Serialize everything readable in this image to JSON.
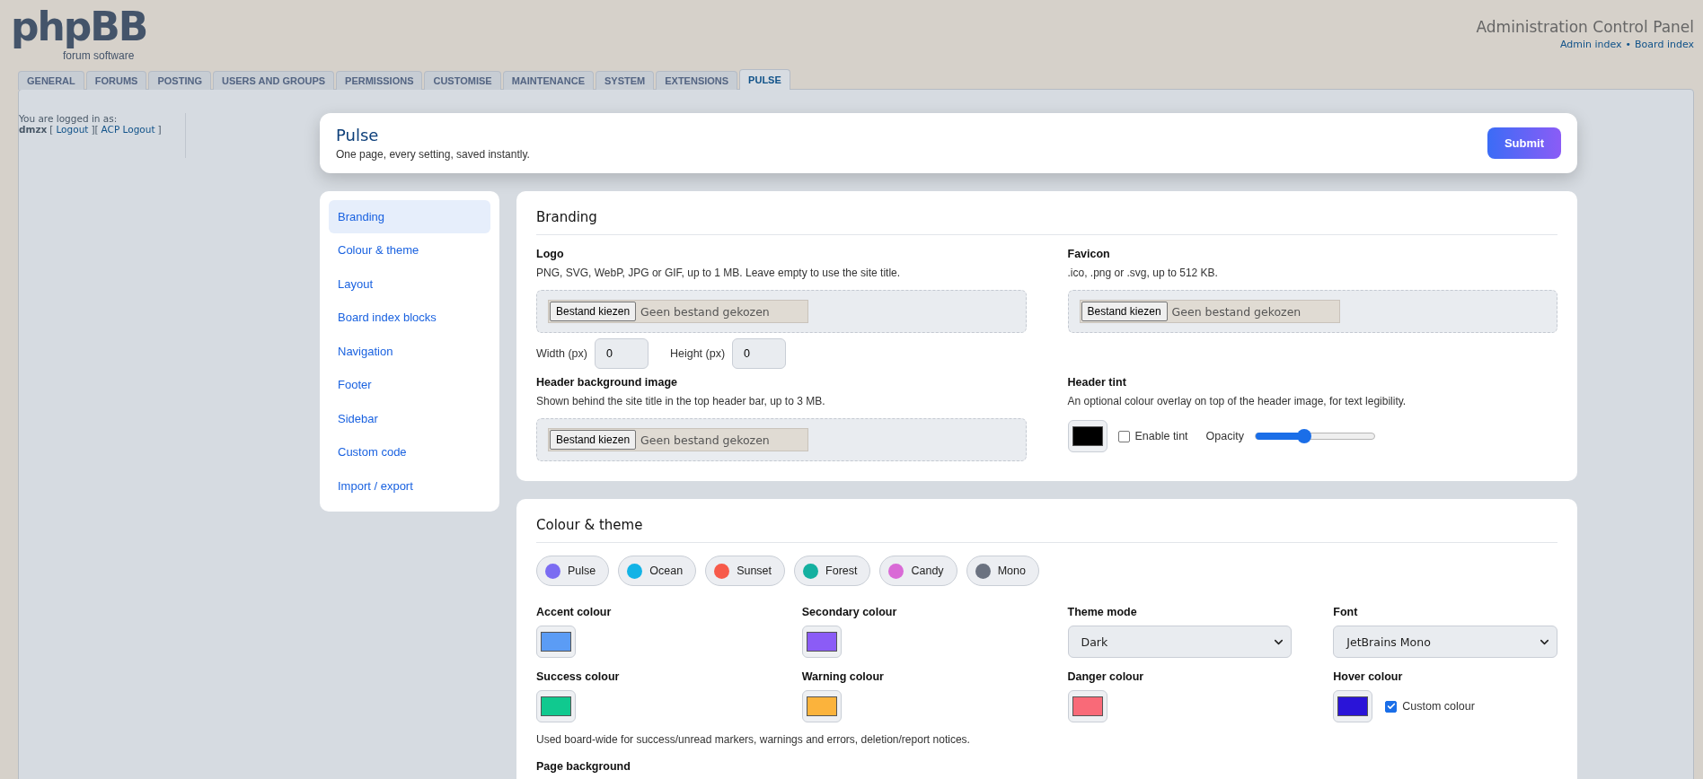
{
  "header": {
    "logo": "phpBB",
    "logo_sub": "forum software",
    "title": "Administration Control Panel",
    "links": [
      "Admin index",
      "Board index"
    ],
    "separator": "•"
  },
  "tabs": [
    {
      "label": "GENERAL",
      "selected": false
    },
    {
      "label": "FORUMS",
      "selected": false
    },
    {
      "label": "POSTING",
      "selected": false
    },
    {
      "label": "USERS AND GROUPS",
      "selected": false
    },
    {
      "label": "PERMISSIONS",
      "selected": false
    },
    {
      "label": "CUSTOMISE",
      "selected": false
    },
    {
      "label": "MAINTENANCE",
      "selected": false
    },
    {
      "label": "SYSTEM",
      "selected": false
    },
    {
      "label": "EXTENSIONS",
      "selected": false
    },
    {
      "label": "PULSE",
      "selected": true
    }
  ],
  "login": {
    "intro": "You are logged in as:",
    "username": "dmzx",
    "parts": [
      {
        "kind": "text",
        "text": "["
      },
      {
        "kind": "link",
        "text": "Logout"
      },
      {
        "kind": "text",
        "text": "]["
      },
      {
        "kind": "link",
        "text": "ACP Logout"
      },
      {
        "kind": "text",
        "text": "]"
      }
    ]
  },
  "page": {
    "title": "Pulse",
    "subtitle": "One page, every setting, saved instantly.",
    "submit": "Submit"
  },
  "nav": [
    {
      "label": "Branding",
      "selected": true
    },
    {
      "label": "Colour & theme",
      "selected": false
    },
    {
      "label": "Layout",
      "selected": false
    },
    {
      "label": "Board index blocks",
      "selected": false
    },
    {
      "label": "Navigation",
      "selected": false
    },
    {
      "label": "Footer",
      "selected": false
    },
    {
      "label": "Sidebar",
      "selected": false
    },
    {
      "label": "Custom code",
      "selected": false
    },
    {
      "label": "Import / export",
      "selected": false
    }
  ],
  "branding": {
    "title": "Branding",
    "logo": {
      "label": "Logo",
      "help": "PNG, SVG, WebP, JPG or GIF, up to 1 MB. Leave empty to use the site title.",
      "button": "Bestand kiezen",
      "status": "Geen bestand gekozen"
    },
    "dims": [
      {
        "label": "Width (px)",
        "value": "0"
      },
      {
        "label": "Height (px)",
        "value": "0"
      }
    ],
    "favicon": {
      "label": "Favicon",
      "help": ".ico, .png or .svg, up to 512 KB.",
      "button": "Bestand kiezen",
      "status": "Geen bestand gekozen"
    },
    "header_image": {
      "label": "Header background image",
      "help": "Shown behind the site title in the top header bar, up to 3 MB.",
      "button": "Bestand kiezen",
      "status": "Geen bestand gekozen"
    },
    "header_tint": {
      "label": "Header tint",
      "help": "An optional colour overlay on top of the header image, for text legibility.",
      "color": "#000000",
      "enable": {
        "label": "Enable tint",
        "checked": false
      },
      "opacity": {
        "label": "Opacity",
        "level": 0.41
      }
    }
  },
  "colour_theme": {
    "title": "Colour & theme",
    "presets": [
      {
        "name": "Pulse",
        "color": "#7b6cf2"
      },
      {
        "name": "Ocean",
        "color": "#12b3e6"
      },
      {
        "name": "Sunset",
        "color": "#f75a4a"
      },
      {
        "name": "Forest",
        "color": "#14b0a0"
      },
      {
        "name": "Candy",
        "color": "#d96ad6"
      },
      {
        "name": "Mono",
        "color": "#6b7280"
      }
    ],
    "fields": [
      {
        "kind": "swatch",
        "label": "Accent colour",
        "color": "#5b9cf5"
      },
      {
        "kind": "swatch",
        "label": "Secondary colour",
        "color": "#8b5cf6"
      },
      {
        "kind": "select",
        "label": "Theme mode",
        "value": "Dark"
      },
      {
        "kind": "select",
        "label": "Font",
        "value": "JetBrains Mono"
      },
      {
        "kind": "swatch",
        "label": "Success colour",
        "color": "#10c98f"
      },
      {
        "kind": "swatch",
        "label": "Warning colour",
        "color": "#fbb33c"
      },
      {
        "kind": "swatch",
        "label": "Danger colour",
        "color": "#f96a78"
      },
      {
        "kind": "swatch",
        "label": "Hover colour",
        "color": "#2a14d8",
        "custom": {
          "label": "Custom colour",
          "checked": true
        }
      }
    ],
    "note": "Used board-wide for success/unread markers, warnings and errors, deletion/report notices.",
    "next_label": "Page background"
  }
}
